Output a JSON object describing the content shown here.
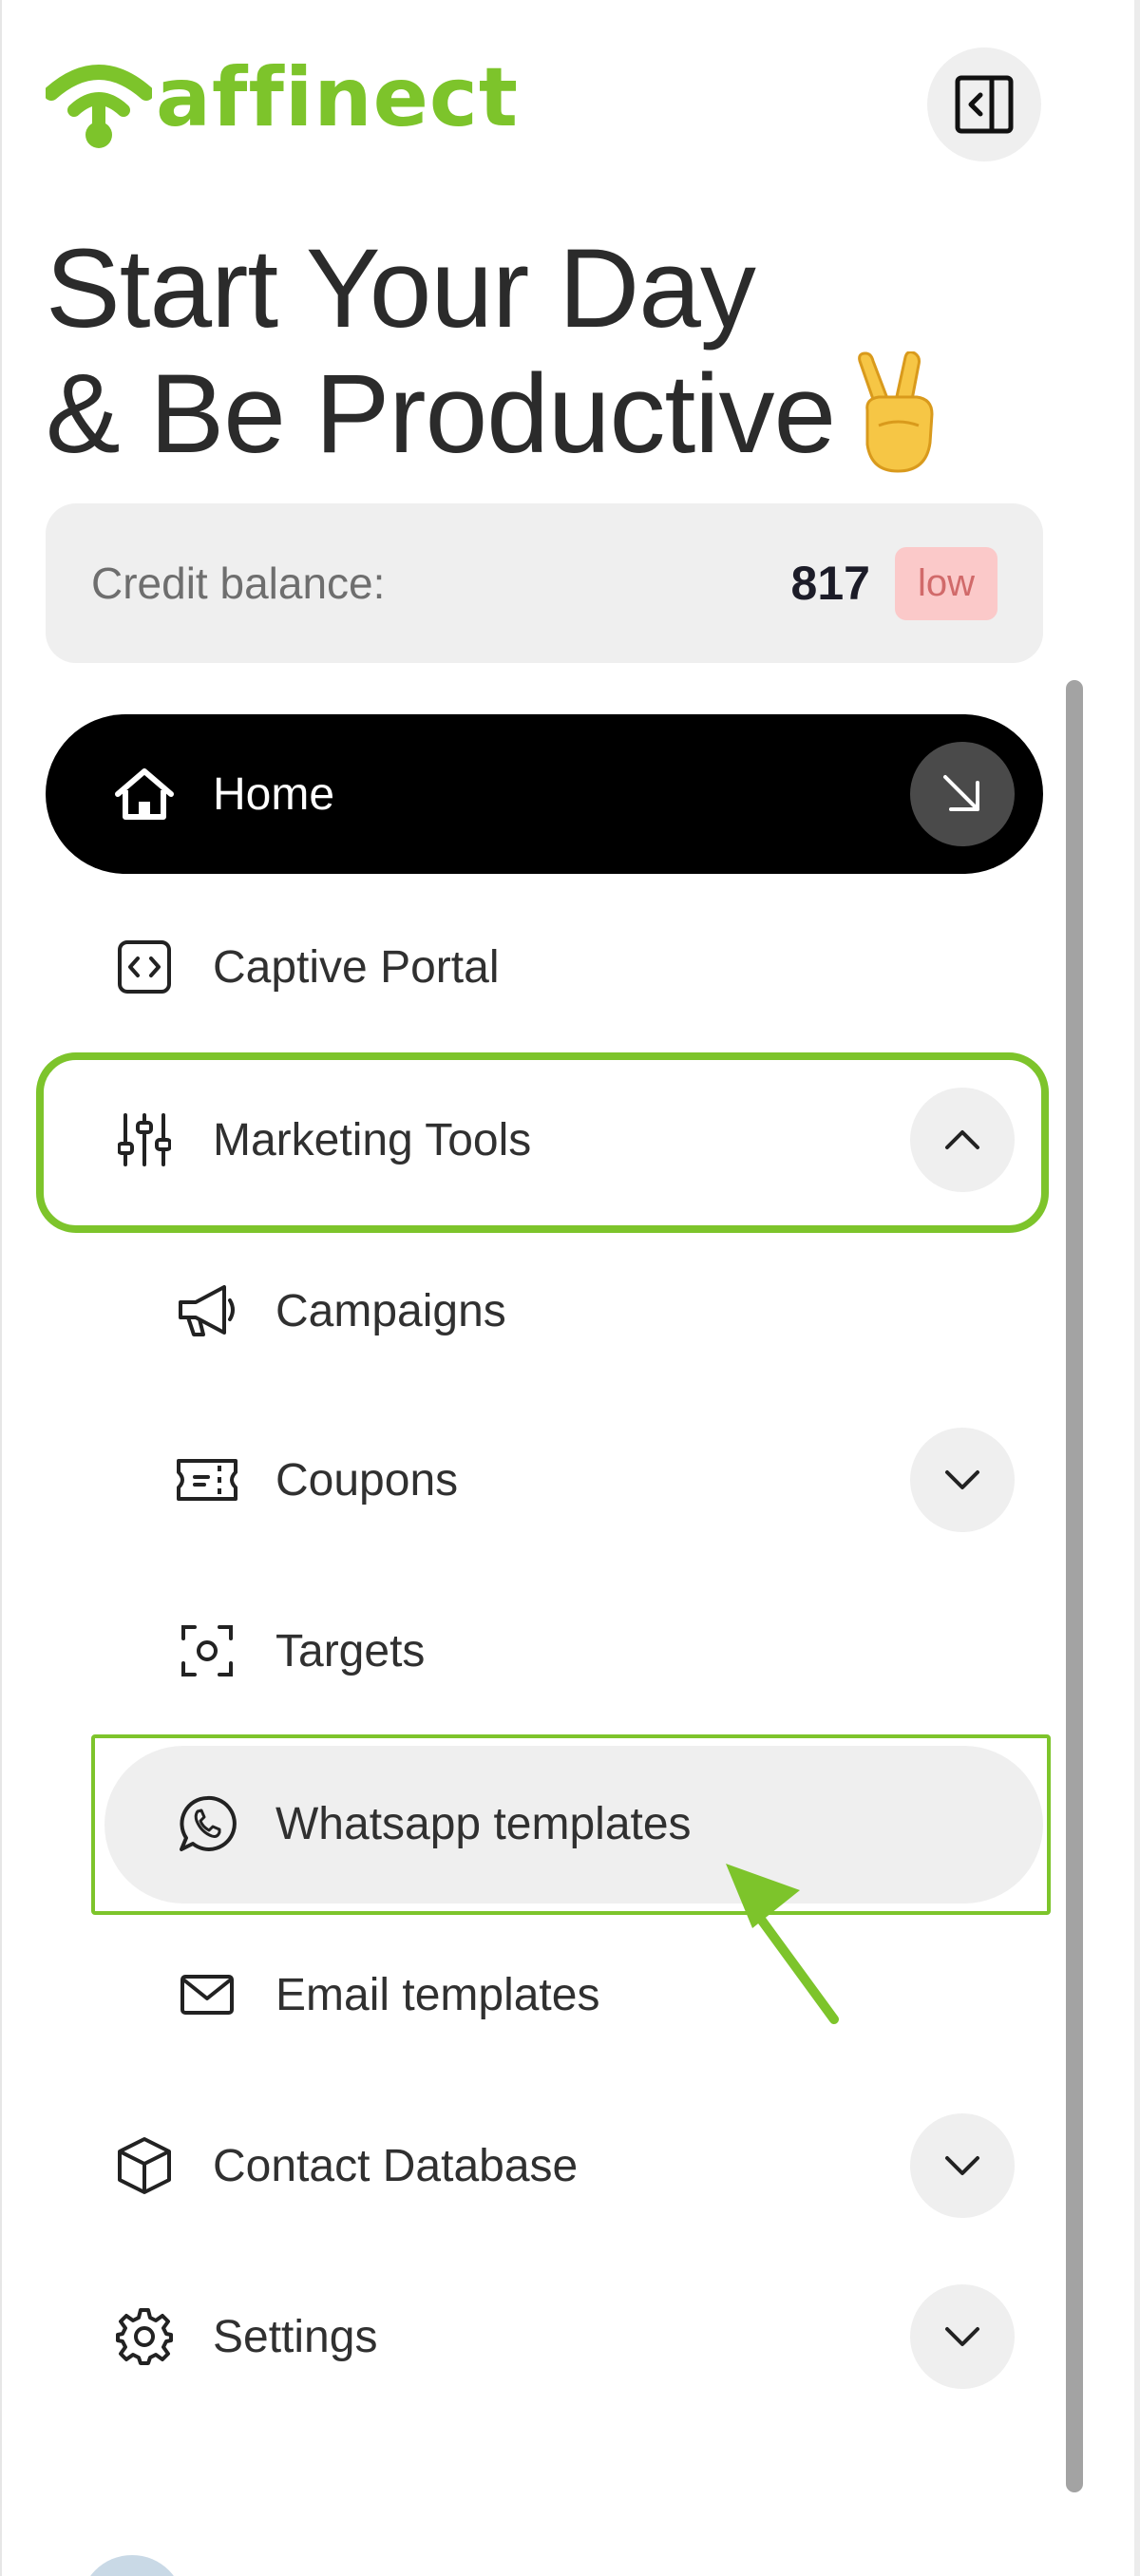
{
  "app": {
    "brand_name": "affinect",
    "brand_color": "#7dc42b",
    "collapse_icon": "sidebar-collapse-icon"
  },
  "headline": {
    "line1": "Start Your Day",
    "line2": "& Be Productive",
    "emoji": "victory-hand-emoji"
  },
  "credit": {
    "label": "Credit balance:",
    "value": "817",
    "badge": "low"
  },
  "nav": {
    "home": {
      "label": "Home",
      "icon": "home-icon",
      "action_icon": "arrow-down-right-icon"
    },
    "captive_portal": {
      "label": "Captive Portal",
      "icon": "code-square-icon"
    },
    "marketing_tools": {
      "label": "Marketing Tools",
      "icon": "sliders-icon",
      "state": "expanded"
    },
    "campaigns": {
      "label": "Campaigns",
      "icon": "megaphone-icon"
    },
    "coupons": {
      "label": "Coupons",
      "icon": "ticket-icon"
    },
    "targets": {
      "label": "Targets",
      "icon": "focus-target-icon"
    },
    "whatsapp_templates": {
      "label": "Whatsapp templates",
      "icon": "whatsapp-icon",
      "state": "hovered"
    },
    "email_templates": {
      "label": "Email templates",
      "icon": "mail-icon"
    },
    "contact_database": {
      "label": "Contact Database",
      "icon": "cube-icon"
    },
    "settings": {
      "label": "Settings",
      "icon": "gear-icon"
    }
  },
  "annotation": {
    "color": "#7dc42b",
    "target": "whatsapp_templates"
  }
}
